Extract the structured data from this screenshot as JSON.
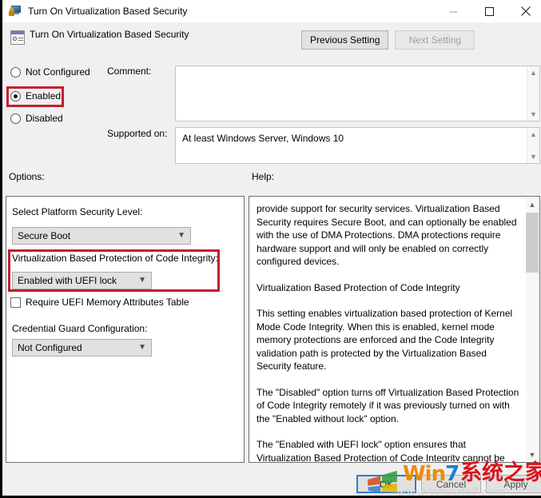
{
  "window": {
    "title": "Turn On Virtualization Based Security",
    "icon": "policy-setting-icon",
    "minimize_label": "Minimize",
    "maximize_label": "Maximize",
    "close_label": "Close"
  },
  "header": {
    "title": "Turn On Virtualization Based Security",
    "previous_button": "Previous Setting",
    "next_button": "Next Setting"
  },
  "state": {
    "options": [
      {
        "label": "Not Configured",
        "checked": false
      },
      {
        "label": "Enabled",
        "checked": true
      },
      {
        "label": "Disabled",
        "checked": false
      }
    ]
  },
  "comment": {
    "label": "Comment:",
    "value": ""
  },
  "supported": {
    "label": "Supported on:",
    "value": "At least Windows Server, Windows 10"
  },
  "options_panel": {
    "label": "Options:",
    "platform_security": {
      "label": "Select Platform Security Level:",
      "value": "Secure Boot"
    },
    "code_integrity": {
      "label": "Virtualization Based Protection of Code Integrity:",
      "value": "Enabled with UEFI lock"
    },
    "uefi_mat": {
      "label": "Require UEFI Memory Attributes Table",
      "checked": false
    },
    "credential_guard": {
      "label": "Credential Guard Configuration:",
      "value": "Not Configured"
    }
  },
  "help_panel": {
    "label": "Help:",
    "paragraphs": [
      "provide support for security services. Virtualization Based Security requires Secure Boot, and can optionally be enabled with the use of DMA Protections. DMA protections require hardware support and will only be enabled on correctly configured devices.",
      "Virtualization Based Protection of Code Integrity",
      "This setting enables virtualization based protection of Kernel Mode Code Integrity. When this is enabled, kernel mode memory protections are enforced and the Code Integrity validation path is protected by the Virtualization Based Security feature.",
      "The \"Disabled\" option turns off Virtualization Based Protection of Code Integrity remotely if it was previously turned on with the \"Enabled without lock\" option.",
      "The \"Enabled with UEFI lock\" option ensures that Virtualization Based Protection of Code Integrity cannot be disabled remotely. In order to disable the feature, you must set the Group Policy to"
    ]
  },
  "footer": {
    "ok": "OK",
    "cancel": "Cancel",
    "apply": "Apply"
  },
  "watermark": {
    "brand_win": "Win",
    "brand_seven": "7",
    "brand_cn": "系统之家",
    "url": "www.Winwin7.com"
  },
  "colors": {
    "highlight_red": "#c41e30",
    "focus_blue": "#2f7fd1",
    "window_bg": "#f0f0f0"
  }
}
